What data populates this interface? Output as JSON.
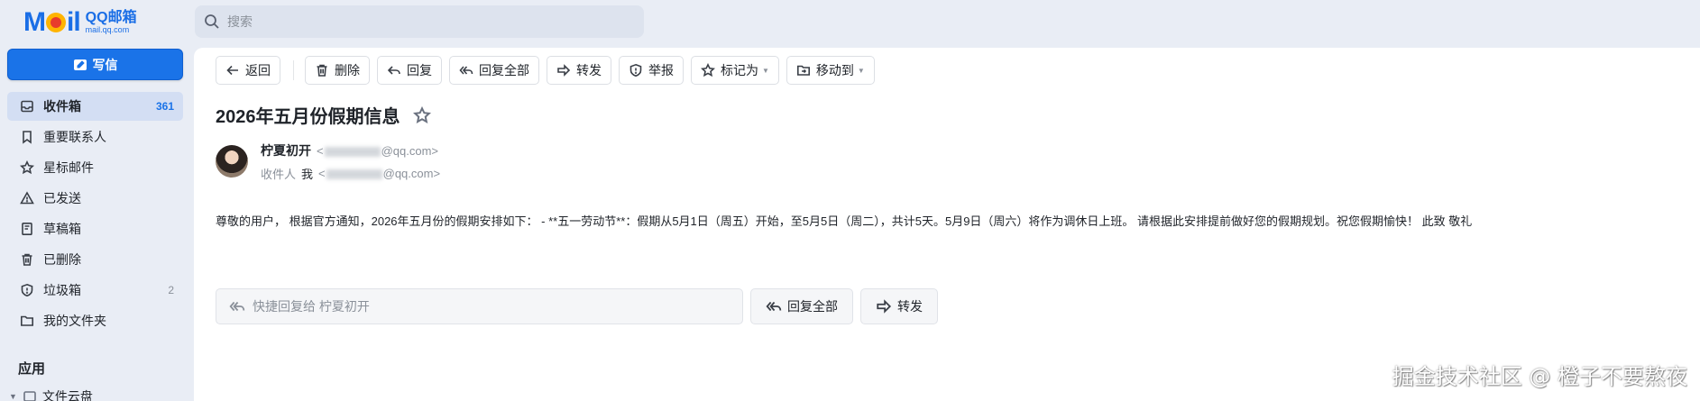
{
  "logo": {
    "mark": "MOil",
    "name": "QQ邮箱",
    "domain": "mail.qq.com"
  },
  "compose": {
    "label": "写信"
  },
  "search": {
    "placeholder": "搜索"
  },
  "sidebar": {
    "items": [
      {
        "label": "收件箱",
        "count": "361",
        "icon": "inbox-icon",
        "active": true
      },
      {
        "label": "重要联系人",
        "count": "",
        "icon": "bookmark-icon"
      },
      {
        "label": "星标邮件",
        "count": "",
        "icon": "star-icon"
      },
      {
        "label": "已发送",
        "count": "",
        "icon": "send-icon"
      },
      {
        "label": "草稿箱",
        "count": "",
        "icon": "draft-icon"
      },
      {
        "label": "已删除",
        "count": "",
        "icon": "trash-icon"
      },
      {
        "label": "垃圾箱",
        "count": "2",
        "icon": "shield-icon"
      },
      {
        "label": "我的文件夹",
        "count": "",
        "icon": "folder-icon"
      }
    ],
    "apps_title": "应用",
    "apps_item": "文件云盘"
  },
  "toolbar": {
    "back": "返回",
    "delete": "删除",
    "reply": "回复",
    "reply_all": "回复全部",
    "forward": "转发",
    "report": "举报",
    "mark_as": "标记为",
    "move_to": "移动到"
  },
  "email": {
    "subject": "2026年五月份假期信息",
    "sender_name": "柠夏初开",
    "sender_email_suffix": "@qq.com>",
    "recipient_label": "收件人",
    "recipient_name": "我",
    "recipient_email_suffix": "@qq.com>",
    "body": "尊敬的用户， 根据官方通知，2026年五月份的假期安排如下： - **五一劳动节**：假期从5月1日（周五）开始，至5月5日（周二），共计5天。5月9日（周六）将作为调休日上班。 请根据此安排提前做好您的假期规划。祝您假期愉快！ 此致 敬礼"
  },
  "quick_reply": {
    "placeholder": "快捷回复给 柠夏初开",
    "reply_all": "回复全部",
    "forward": "转发"
  },
  "watermark": "掘金技术社区 @ 橙子不要熬夜",
  "colors": {
    "accent": "#1a73e8",
    "sidebar_bg": "#e9edf5",
    "active_item": "#d3def3"
  }
}
